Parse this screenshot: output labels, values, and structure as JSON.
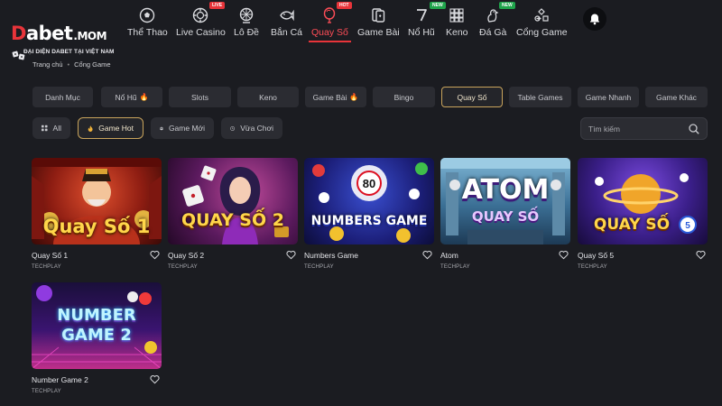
{
  "logo": {
    "brand_d": "D",
    "brand_rest": "abet",
    "brand_suffix": ".MOM",
    "tagline": "ĐẠI DIỆN DABET TẠI VIỆT NAM"
  },
  "nav": {
    "items": [
      {
        "label": "Thể Thao",
        "icon": "soccer-ball-icon",
        "badge": ""
      },
      {
        "label": "Live Casino",
        "icon": "casino-chip-icon",
        "badge": "LIVE"
      },
      {
        "label": "Lô Đề",
        "icon": "lottery-wheel-icon",
        "badge": ""
      },
      {
        "label": "Bắn Cá",
        "icon": "fish-icon",
        "badge": ""
      },
      {
        "label": "Quay Số",
        "icon": "balloon-icon",
        "badge": "HOT"
      },
      {
        "label": "Game Bài",
        "icon": "cards-icon",
        "badge": ""
      },
      {
        "label": "Nổ Hũ",
        "icon": "slot-seven-icon",
        "badge": "NEW"
      },
      {
        "label": "Keno",
        "icon": "keno-grid-icon",
        "badge": ""
      },
      {
        "label": "Đá Gà",
        "icon": "rooster-icon",
        "badge": "NEW"
      },
      {
        "label": "Cổng Game",
        "icon": "gamepad-icon",
        "badge": ""
      }
    ],
    "active": "Quay Số"
  },
  "breadcrumb": {
    "home": "Trang chủ",
    "current": "Cổng Game"
  },
  "categories": [
    "Danh Mục",
    "Nổ Hũ",
    "Slots",
    "Keno",
    "Game Bài",
    "Bingo",
    "Quay Số",
    "Table Games",
    "Game Nhanh",
    "Game Khác"
  ],
  "category_fire": [
    "Nổ Hũ",
    "Game Bài"
  ],
  "active_category": "Quay Số",
  "filters": [
    {
      "label": "All",
      "icon": "grid-icon"
    },
    {
      "label": "Game Hot",
      "icon": "flame-icon"
    },
    {
      "label": "Game Mới",
      "icon": "new-icon"
    },
    {
      "label": "Vừa Chơi",
      "icon": "history-icon"
    }
  ],
  "active_filter": "Game Hot",
  "search": {
    "placeholder": "Tìm kiếm"
  },
  "games": [
    {
      "name": "Quay Số 1",
      "provider": "TECHPLAY",
      "art_title": "Quay Số 1"
    },
    {
      "name": "Quay Số 2",
      "provider": "TECHPLAY",
      "art_title": "QUAY SỐ 2"
    },
    {
      "name": "Numbers Game",
      "provider": "TECHPLAY",
      "art_title": "NUMBERS GAME"
    },
    {
      "name": "Atom",
      "provider": "TECHPLAY",
      "art_title": "ATOM"
    },
    {
      "name": "Quay Số 5",
      "provider": "TECHPLAY",
      "art_title": "QUAY SỐ"
    },
    {
      "name": "Number Game 2",
      "provider": "TECHPLAY",
      "art_title": "NUMBER GAME 2"
    }
  ],
  "colors": {
    "accent_red": "#e8343a",
    "active_gold": "#c9a45c",
    "background": "#1b1c21",
    "tab_bg": "#2b2c32"
  }
}
